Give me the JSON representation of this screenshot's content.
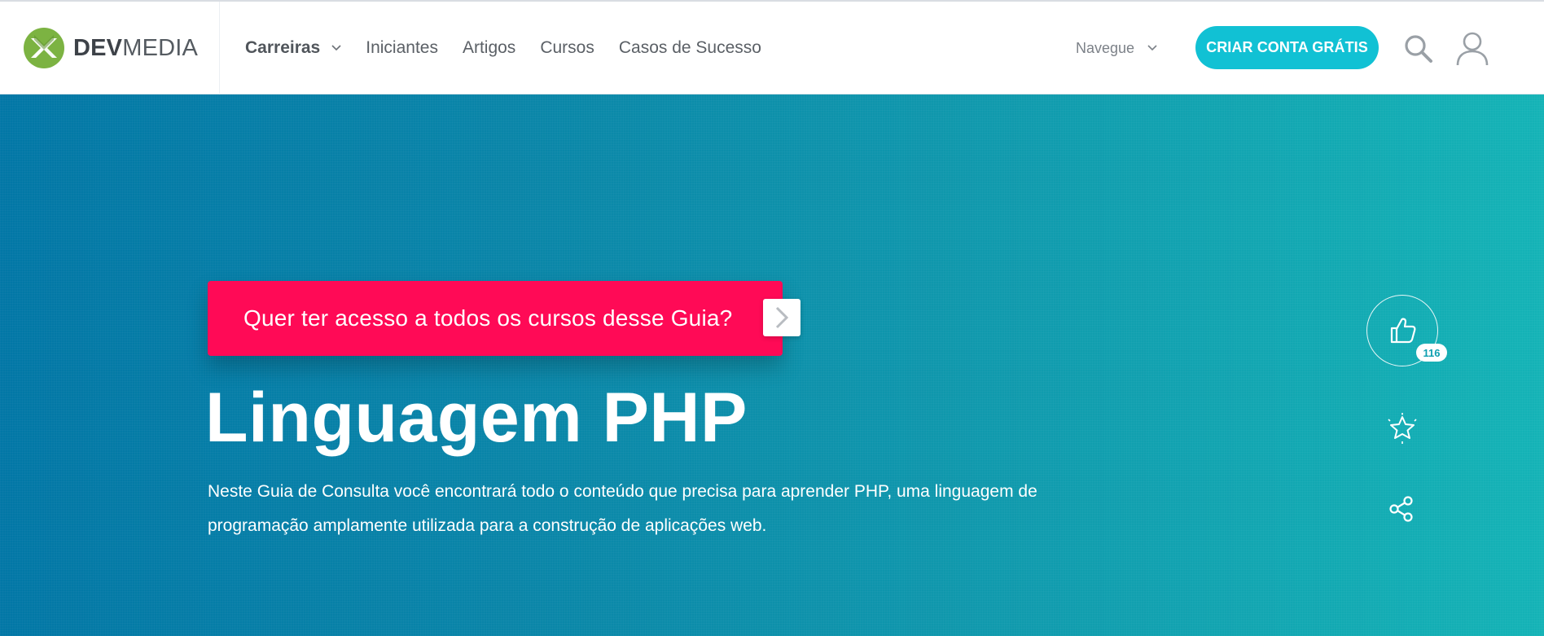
{
  "brand": {
    "dev": "DEV",
    "media": "MEDIA"
  },
  "nav": {
    "items": [
      {
        "label": "Carreiras",
        "has_dropdown": true
      },
      {
        "label": "Iniciantes"
      },
      {
        "label": "Artigos"
      },
      {
        "label": "Cursos"
      },
      {
        "label": "Casos de Sucesso"
      }
    ],
    "navegue_label": "Navegue",
    "cta_label": "CRIAR CONTA GRÁTIS"
  },
  "hero": {
    "promo_label": "Quer ter acesso a todos os cursos desse Guia?",
    "title": "Linguagem PHP",
    "description": "Neste Guia de Consulta você encontrará todo o conteúdo que precisa para aprender PHP, uma linguagem de programação amplamente utilizada para a construção de aplicações web.",
    "likes": "116"
  },
  "icons": {
    "logo": "devmedia-logo",
    "search": "search-icon",
    "user": "user-icon",
    "like": "thumbs-up-icon",
    "favorite": "star-icon",
    "share": "share-icon",
    "chevron": "chevron-down-icon",
    "arrow": "chevron-right-icon"
  },
  "colors": {
    "cta": "#11c1d4",
    "promo": "#ff0a56",
    "hero_start": "#0277a6",
    "hero_end": "#14b3b6",
    "logo_green": "#7cb342"
  }
}
